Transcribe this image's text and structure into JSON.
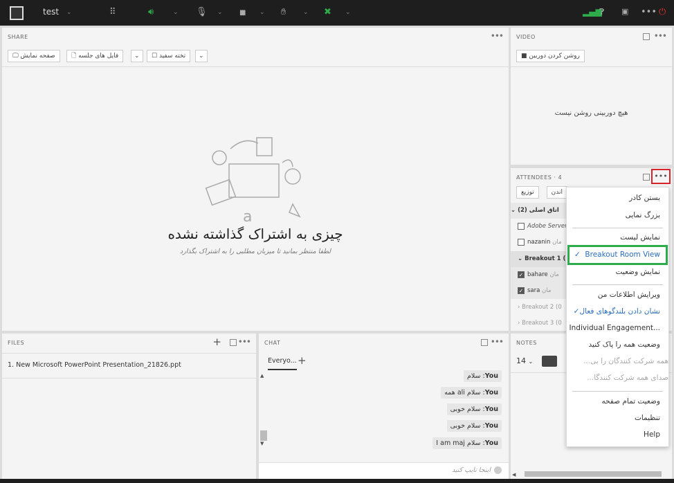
{
  "topbar": {
    "meeting_title": "test",
    "icons": [
      "app-logo",
      "apps-grid-icon",
      "speaker-icon",
      "microphone-icon",
      "camera-icon",
      "raise-hand-icon",
      "layout-icon",
      "signal-icon",
      "help-icon",
      "fullscreen-icon",
      "more-icon",
      "power-icon"
    ],
    "accent_green": "#2eab4a",
    "power_color": "#d9332a"
  },
  "share": {
    "title": "SHARE",
    "buttons": [
      "صفحه نمایش",
      "فایل های جلسه",
      "تخته سفید"
    ],
    "empty_title": "چیزی به اشتراک گذاشته نشده",
    "empty_sub": "لطفا منتظر بمانید تا میزبان مطلبی را به اشتراک بگذارد"
  },
  "video": {
    "title": "VIDEO",
    "camera_button": "روشن کردن دوربین",
    "empty": "هیچ دوربینی روشن نیست"
  },
  "attendees": {
    "title": "ATTENDEES",
    "count": "· 4",
    "buttons": [
      "توزیع",
      "اندن"
    ],
    "groups": [
      {
        "label": "اتاق اصلی (2)",
        "expanded": true,
        "members": [
          {
            "name": "Adobe Server",
            "role": "",
            "checked": false
          },
          {
            "name": "nazanin",
            "role": "مان",
            "checked": false
          }
        ]
      },
      {
        "label": "Breakout 1 (2",
        "expanded": true,
        "members": [
          {
            "name": "bahare",
            "role": "مان",
            "checked": true
          },
          {
            "name": "sara",
            "role": "مان",
            "checked": true
          }
        ]
      },
      {
        "label": "Breakout 2 (0",
        "expanded": false
      },
      {
        "label": "Breakout 3 (0",
        "expanded": false
      }
    ]
  },
  "menu": {
    "items": [
      "بستن کادر",
      "بزرگ نمایی",
      "نمایش لیست",
      "Breakout Room View",
      "نمایش وضعیت",
      "ویرایش اطلاعات من",
      "نشان دادن بلندگوهای فعال",
      "Individual Engagement...",
      "وضعیت همه را پاک کنید",
      "همه شرکت کنندگان را بی...",
      "صدای همه شرکت کنندگا...",
      "وضعیت تمام صفحه",
      "تنظیمات",
      "Help"
    ],
    "selected": "Breakout Room View",
    "highlight_color": "#2eab4a",
    "checked_link_color": "#2a6ebb"
  },
  "files": {
    "title": "FILES",
    "items": [
      "1. New Microsoft PowerPoint Presentation_21826.ppt"
    ]
  },
  "chat": {
    "title": "CHAT",
    "tab": "Everyo...",
    "messages": [
      {
        "sender": "You",
        "text": "سلام"
      },
      {
        "sender": "You",
        "text": "سلام ali همه"
      },
      {
        "sender": "You",
        "text": "سلام خوبی"
      },
      {
        "sender": "You",
        "text": "سلام خوبی"
      },
      {
        "sender": "You",
        "text": "سلام I am maj"
      }
    ],
    "input_placeholder": "اینجا تایپ کنید"
  },
  "notes": {
    "title": "NOTES",
    "font_size": "14",
    "color": "#444444"
  }
}
